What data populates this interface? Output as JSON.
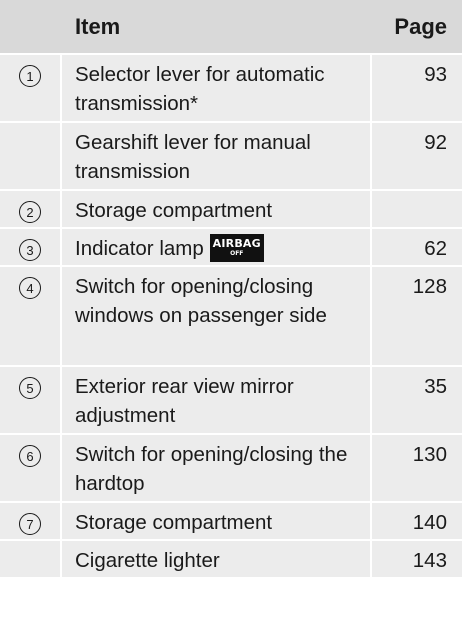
{
  "header": {
    "item": "Item",
    "page": "Page"
  },
  "rows": [
    {
      "num": "1",
      "text": "Selector lever for automatic transmission*",
      "page": "93"
    },
    {
      "num": "",
      "text": "Gearshift lever for manual transmission",
      "page": "92"
    },
    {
      "num": "2",
      "text": "Storage compartment",
      "page": ""
    },
    {
      "num": "3",
      "text": "Indicator lamp",
      "page": "62",
      "badge": {
        "line1": "AIRBAG",
        "line2": "OFF"
      }
    },
    {
      "num": "4",
      "text": "Switch for opening/closing windows on passenger side",
      "page": "128"
    },
    {
      "num": "5",
      "text": "Exterior rear view mirror adjustment",
      "page": "35"
    },
    {
      "num": "6",
      "text": "Switch for opening/closing the hardtop",
      "page": "130"
    },
    {
      "num": "7",
      "text": "Storage compartment",
      "page": "140"
    },
    {
      "num": "",
      "text": "Cigarette lighter",
      "page": "143"
    }
  ]
}
